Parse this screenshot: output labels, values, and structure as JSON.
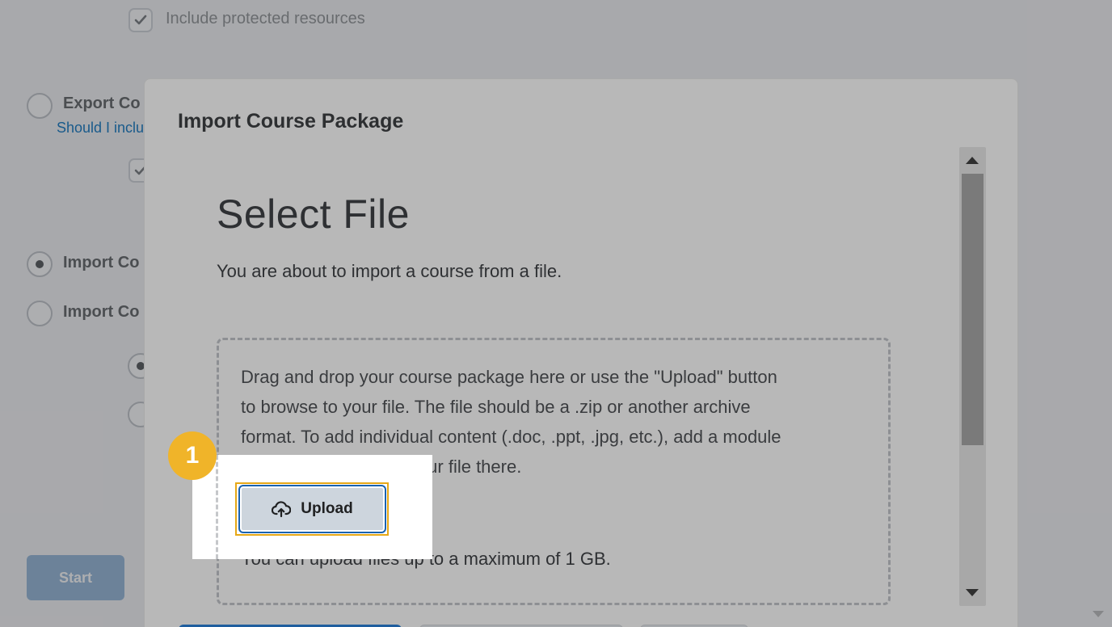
{
  "background": {
    "protected_checkbox_label": "Include protected resources",
    "export_option_label": "Export Co",
    "export_help_link": "Should I inclu",
    "import_option_1_label": "Import Co",
    "import_option_2_label": "Import Co",
    "start_button_label": "Start"
  },
  "modal": {
    "title": "Import Course Package",
    "heading": "Select File",
    "description": "You are about to import a course from a file.",
    "dropzone": {
      "instructions_lines": [
        "Drag and drop your course package here or use the \"Upload\" button",
        "to browse to your file. The file should be a .zip or another archive",
        "format. To add individual content (.doc, .ppt, .jpg, etc.), add a module",
        "in Content and place your file there."
      ],
      "upload_button_label": "Upload",
      "size_limit_text": "You can upload files up to a maximum of 1 GB."
    }
  },
  "callout": {
    "step_number": "1"
  },
  "colors": {
    "accent_blue": "#1b63b0",
    "callout_yellow": "#f0b429",
    "highlight_border": "#e6a817",
    "start_button_bg": "#8fb3d8"
  },
  "icons": {
    "upload": "cloud-upload-icon",
    "check": "check-icon",
    "scroll_up": "triangle-up-icon",
    "scroll_down": "triangle-down-icon"
  }
}
